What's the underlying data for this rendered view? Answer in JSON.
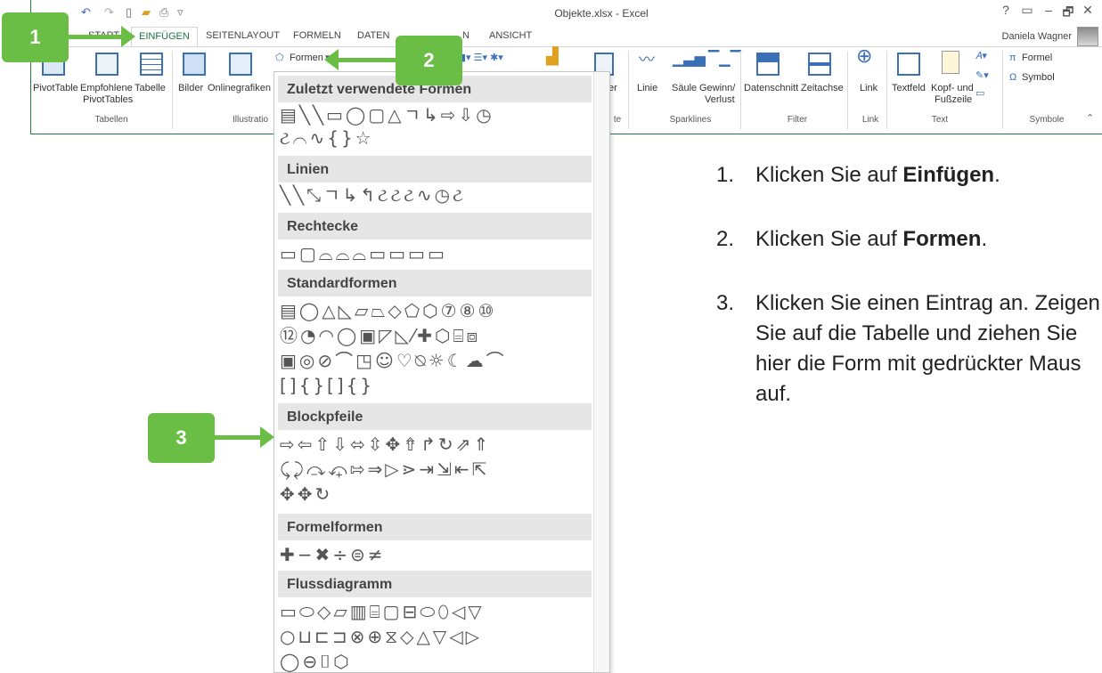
{
  "window": {
    "title": "Objekte.xlsx - Excel",
    "user": "Daniela Wagner",
    "controls": [
      "?",
      "▭",
      "–",
      "🗗",
      "✕"
    ]
  },
  "tabs": [
    {
      "label": "START",
      "active": false
    },
    {
      "label": "EINFÜGEN",
      "active": true
    },
    {
      "label": "SEITENLAYOUT",
      "active": false
    },
    {
      "label": "FORMELN",
      "active": false
    },
    {
      "label": "DATEN",
      "active": false
    },
    {
      "label": "N",
      "active": false
    },
    {
      "label": "ANSICHT",
      "active": false
    }
  ],
  "ribbon": {
    "buttons": {
      "pivottable": "PivotTable",
      "empfohlene": "Empfohlene",
      "pivottables": "PivotTables",
      "tabelle": "Tabelle",
      "bilder": "Bilder",
      "onlinegrafiken": "Onlinegrafiken",
      "formen": "Formen",
      "er": "er",
      "linie": "Linie",
      "saeule": "Säule",
      "gewinn": "Gewinn/",
      "verlust": "Verlust",
      "datenschnitt": "Datenschnitt",
      "zeitachse": "Zeitachse",
      "link": "Link",
      "textfeld": "Textfeld",
      "kopfund": "Kopf- und",
      "fusszeile": "Fußzeile",
      "formel": "Formel",
      "symbol": "Symbol"
    },
    "groups": {
      "tabellen": "Tabellen",
      "illustrationen": "Illustratio",
      "te": "te",
      "sparklines": "Sparklines",
      "filter": "Filter",
      "link": "Link",
      "text": "Text",
      "symbole": "Symbole"
    }
  },
  "dropdown": {
    "sections": [
      {
        "title": "Zuletzt verwendete Formen",
        "rows": [
          "▤╲╲▭◯▢△ㄱ↳⇨⇩◷",
          "ટ⌒∿{}☆"
        ]
      },
      {
        "title": "Linien",
        "rows": [
          "╲╲⤡ㄱ↳↰ટટટ∿◷ટ"
        ]
      },
      {
        "title": "Rechtecke",
        "rows": [
          "▭▢⌓⌓⌓▭▭▭▭"
        ]
      },
      {
        "title": "Standardformen",
        "rows": [
          "▤◯△◺▱⏢◇⬠⬡⑦⑧⑩",
          "⑫◔◠◯▣◸◺⁄✚⬡⌸⧈",
          "▣◎⊘⌒◳☺♡⍉☼☾☁⌒",
          "[]{}[]{}"
        ]
      },
      {
        "title": "Blockpfeile",
        "rows": [
          "⇨⇦⇧⇩⬄⇳✥⇮↱↻⇗⇑",
          "⤹⤸⤼⤽⇰⇒▷⋗⇥⇲⇤⇱",
          "✥✥↻"
        ]
      },
      {
        "title": "Formelformen",
        "rows": [
          "✚−✖÷⊜≠"
        ]
      },
      {
        "title": "Flussdiagramm",
        "rows": [
          "▭⬭◇▱▥⌸▢⊟⬭⬯◁▽",
          "○⊔⊏⊐⊗⊕⧖◇△▽◁▷",
          "◯⊖⌷⬡"
        ]
      }
    ]
  },
  "callouts": [
    "1",
    "2",
    "3"
  ],
  "steps": [
    {
      "num": "1.",
      "text_before": "Klicken Sie auf ",
      "bold": "Einfügen",
      "text_after": "."
    },
    {
      "num": "2.",
      "text_before": "Klicken Sie auf ",
      "bold": "Formen",
      "text_after": "."
    },
    {
      "num": "3.",
      "text_before": "Klicken Sie einen Eintrag an. Zeigen Sie auf die Tabelle und ziehen Sie hier die Form mit gedrückter Maus auf.",
      "bold": "",
      "text_after": ""
    }
  ],
  "colors": {
    "accent_green": "#6bbe45",
    "excel_green": "#217346"
  }
}
